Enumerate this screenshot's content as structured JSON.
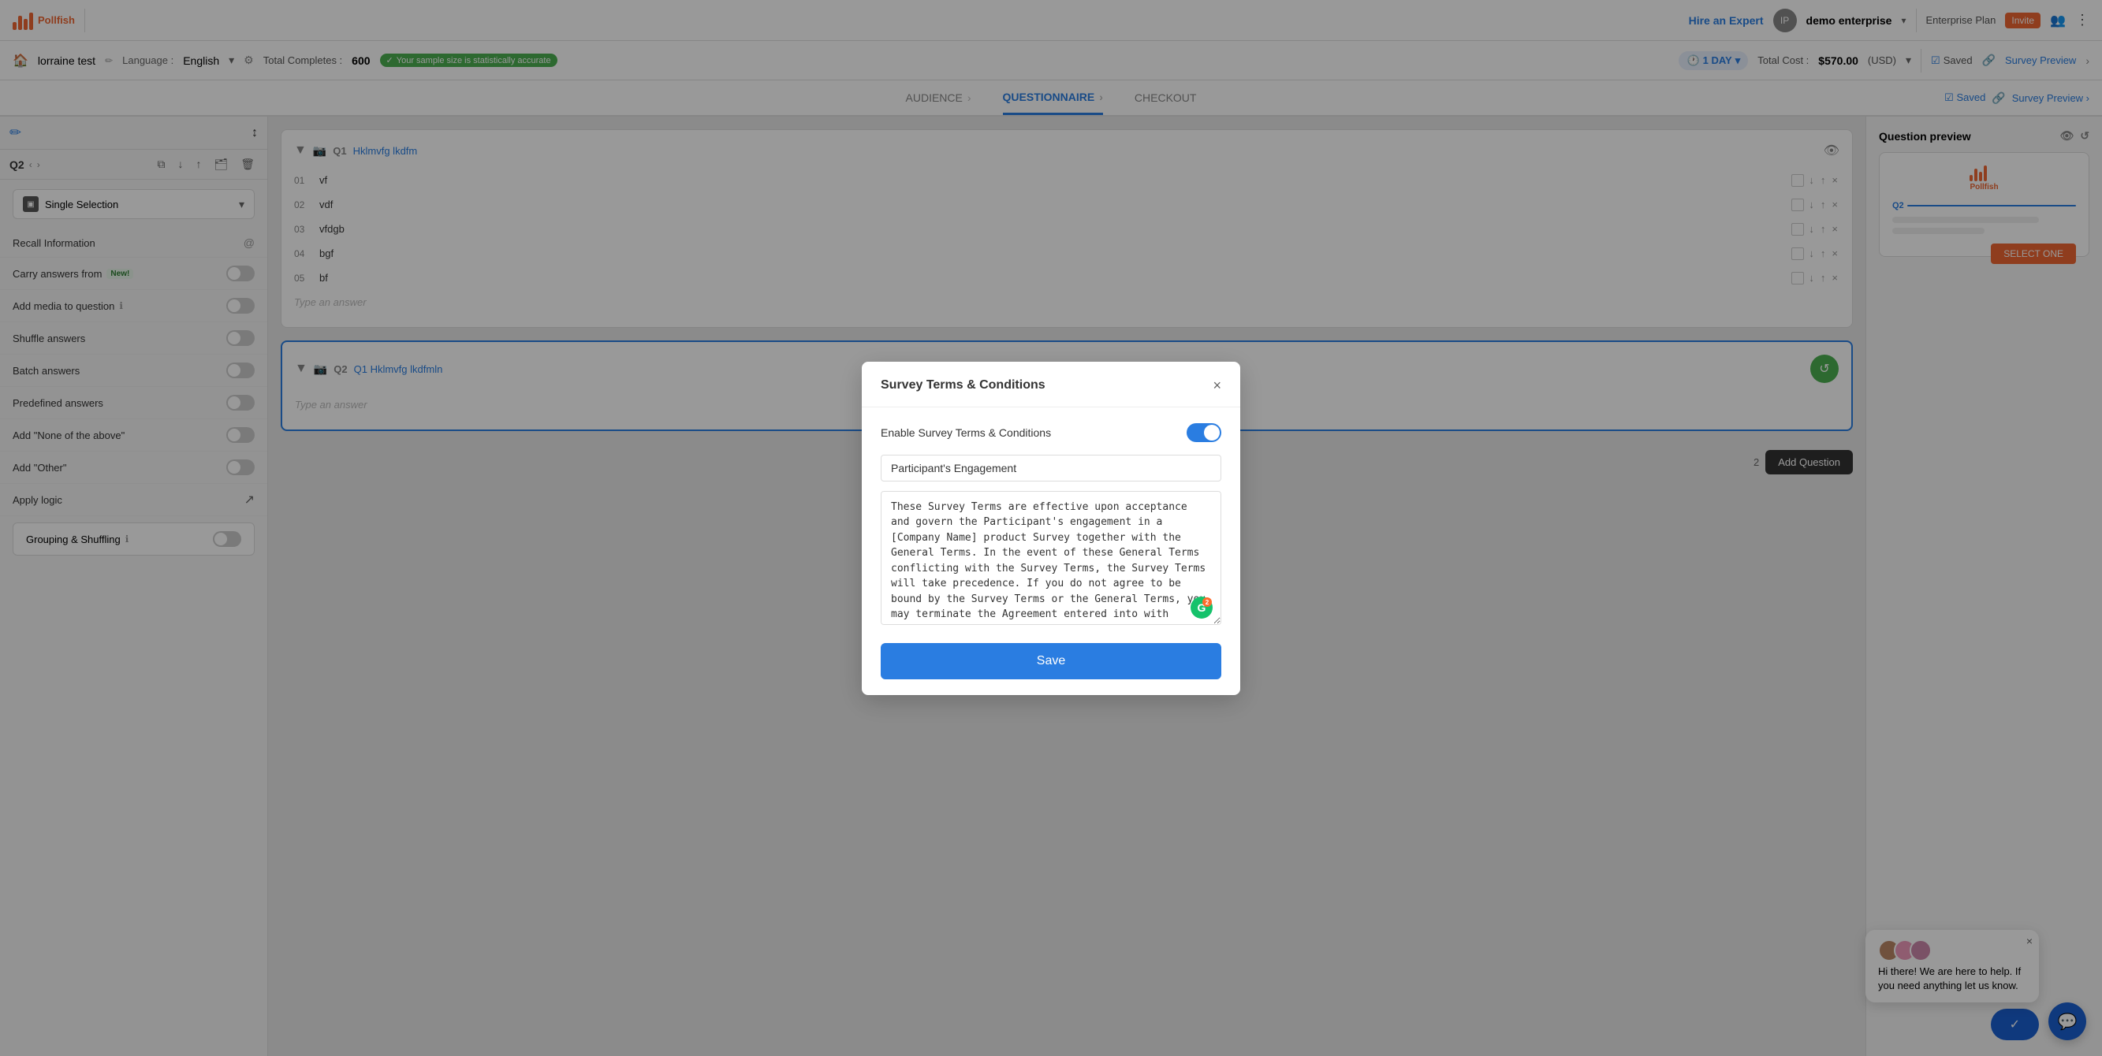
{
  "app": {
    "name": "Pollfish",
    "logo_alt": "Pollfish logo"
  },
  "topnav": {
    "hire_expert": "Hire an Expert",
    "user_initial": "IP",
    "user_name": "demo enterprise",
    "plan": "Enterprise Plan",
    "invite_label": "Invite",
    "more_label": "⋮"
  },
  "survey_bar": {
    "survey_name": "lorraine test",
    "language_label": "Language :",
    "language_value": "English",
    "total_completes_label": "Total Completes :",
    "total_completes_value": "600",
    "accurate_label": "Your sample size is statistically accurate",
    "time_label": "1 DAY",
    "total_cost_label": "Total Cost :",
    "total_cost_value": "$570.00",
    "cost_currency": "(USD)",
    "saved_label": "Saved",
    "preview_label": "Survey Preview"
  },
  "tabs": {
    "audience": "AUDIENCE",
    "questionnaire": "QUESTIONNAIRE",
    "checkout": "CHECKOUT"
  },
  "left_panel": {
    "q_label": "Q2",
    "question_type": "Single Selection",
    "options": [
      {
        "label": "Recall Information",
        "has_toggle": true,
        "toggle_on": false,
        "has_icon": "@"
      },
      {
        "label": "Carry answers from",
        "has_toggle": true,
        "toggle_on": false,
        "is_new": true
      },
      {
        "label": "Add media to question",
        "has_toggle": true,
        "toggle_on": false,
        "has_info": true
      },
      {
        "label": "Shuffle answers",
        "has_toggle": true,
        "toggle_on": false
      },
      {
        "label": "Batch answers",
        "has_toggle": true,
        "toggle_on": false
      },
      {
        "label": "Predefined answers",
        "has_toggle": true,
        "toggle_on": false
      },
      {
        "label": "Add \"None of the above\"",
        "has_toggle": true,
        "toggle_on": false
      },
      {
        "label": "Add \"Other\"",
        "has_toggle": true,
        "toggle_on": false
      },
      {
        "label": "Apply logic",
        "has_toggle": false,
        "has_arrow": true
      }
    ],
    "grouping_label": "Grouping & Shuffling",
    "grouping_toggle_on": false
  },
  "center_panel": {
    "questions": [
      {
        "id": "Q1",
        "text": "Hklmvfg lkdfm",
        "answers": [
          {
            "num": "01",
            "text": "vf"
          },
          {
            "num": "02",
            "text": "vdf"
          },
          {
            "num": "03",
            "text": "vfdgb"
          },
          {
            "num": "04",
            "text": "bgf"
          },
          {
            "num": "05",
            "text": "bf"
          }
        ],
        "type_answer_placeholder": "Type an answer"
      },
      {
        "id": "Q2",
        "text": "Q1 Hklmvfg lkdfmln",
        "answers": [],
        "type_answer_placeholder": "Type an answer"
      }
    ],
    "add_question_label": "Add Question"
  },
  "right_panel": {
    "title": "Question preview",
    "q2_label": "Q2",
    "select_one_label": "SELECT ONE"
  },
  "modal": {
    "title": "Survey Terms & Conditions",
    "toggle_label": "Enable Survey Terms & Conditions",
    "toggle_on": true,
    "title_placeholder": "Participant's Engagement",
    "body_text": "These Survey Terms are effective upon acceptance and govern the Participant's engagement in a [Company Name] product Survey together with the General Terms. In the event of these General Terms conflicting with the Survey Terms, the Survey Terms will take precedence. If you do not agree to be bound by the Survey Terms or the General Terms, you may terminate the Agreement entered into with [Company Name]  at any time by sending an email to legal@companyname.com.",
    "save_label": "Save"
  },
  "chat": {
    "message": "Hi there! We are here to help. If you need anything let us know.",
    "close_label": "×",
    "confirm_icon": "✓"
  }
}
